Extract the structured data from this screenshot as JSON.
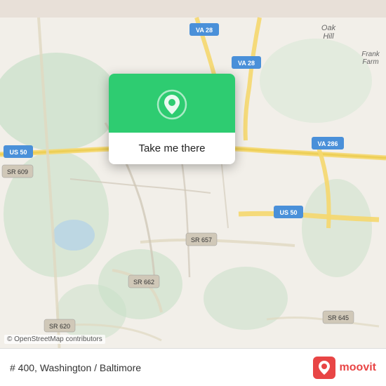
{
  "map": {
    "background_color": "#e8e0d8",
    "attribution": "© OpenStreetMap contributors"
  },
  "popup": {
    "button_label": "Take me there",
    "icon_bg_color": "#2ecc71"
  },
  "bottom_bar": {
    "address": "# 400, Washington / Baltimore",
    "logo_text": "moovit"
  },
  "icons": {
    "location_pin": "location-pin-icon",
    "moovit_logo": "moovit-logo-icon"
  }
}
